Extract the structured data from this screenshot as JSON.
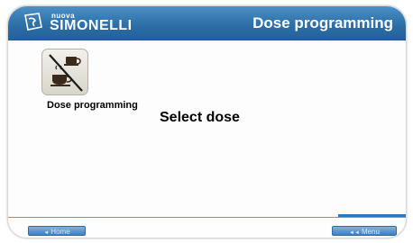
{
  "header": {
    "brand_small": "nuova",
    "brand_name": "SIMONELLI",
    "title": "Dose programming"
  },
  "main": {
    "icon_label": "Dose programming",
    "prompt": "Select dose"
  },
  "footer": {
    "home_label": "Home",
    "menu_label": "Menu"
  },
  "colors": {
    "header": "#2d6fa8",
    "accent": "#5aa0d8"
  },
  "icons": [
    "simonelli-logo-icon",
    "cup-crossed-icon",
    "arrow-left-icon",
    "arrow-right-icon"
  ]
}
